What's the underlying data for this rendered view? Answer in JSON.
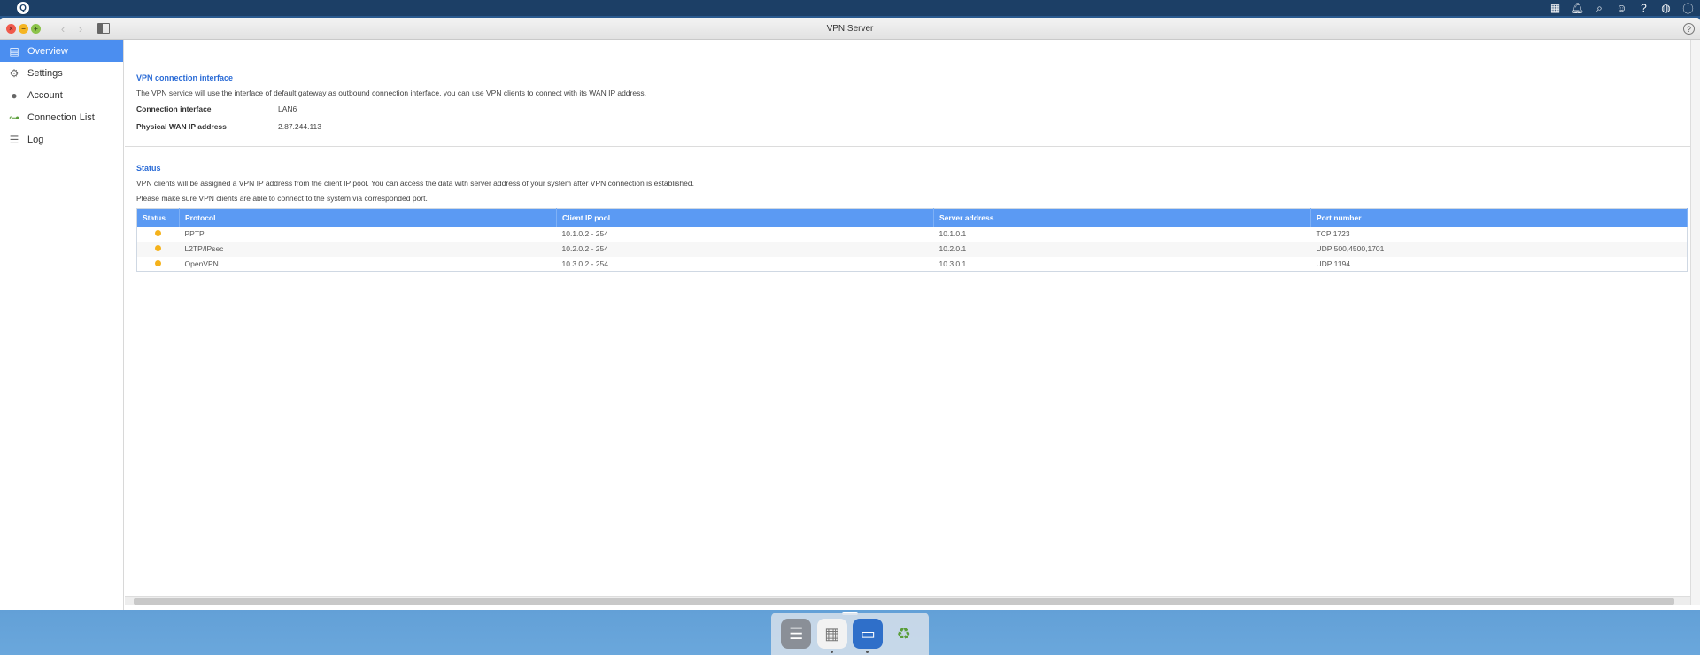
{
  "window": {
    "title": "VPN Server"
  },
  "sidebar": {
    "items": [
      {
        "label": "Overview",
        "icon": "overview-icon",
        "active": true
      },
      {
        "label": "Settings",
        "icon": "gear-icon",
        "active": false
      },
      {
        "label": "Account",
        "icon": "user-icon",
        "active": false
      },
      {
        "label": "Connection List",
        "icon": "connection-icon",
        "active": false
      },
      {
        "label": "Log",
        "icon": "log-icon",
        "active": false
      }
    ]
  },
  "vpn_interface": {
    "title": "VPN connection interface",
    "description": "The VPN service will use the interface of default gateway as outbound connection interface, you can use VPN clients to connect with its WAN IP address.",
    "connection_interface_label": "Connection interface",
    "connection_interface_value": "LAN6",
    "wan_ip_label": "Physical WAN IP address",
    "wan_ip_value": "2.87.244.113"
  },
  "status": {
    "title": "Status",
    "desc1": "VPN clients will be assigned a VPN IP address from the client IP pool. You can access the data with server address of your system after VPN connection is established.",
    "desc2": "Please make sure VPN clients are able to connect to the system via corresponded port.",
    "columns": [
      "Status",
      "Protocol",
      "Client IP pool",
      "Server address",
      "Port number"
    ],
    "rows": [
      {
        "protocol": "PPTP",
        "pool": "10.1.0.2 - 254",
        "server": "10.1.0.1",
        "port": "TCP 1723",
        "status_color": "#f5b21b"
      },
      {
        "protocol": "L2TP/IPsec",
        "pool": "10.2.0.2 - 254",
        "server": "10.2.0.1",
        "port": "UDP 500,4500,1701",
        "status_color": "#f5b21b"
      },
      {
        "protocol": "OpenVPN",
        "pool": "10.3.0.2 - 254",
        "server": "10.3.0.1",
        "port": "UDP 1194",
        "status_color": "#f5b21b"
      }
    ]
  },
  "colors": {
    "accent": "#4b8ef0",
    "table_header": "#5b9af3",
    "status_dot": "#f5b21b"
  }
}
